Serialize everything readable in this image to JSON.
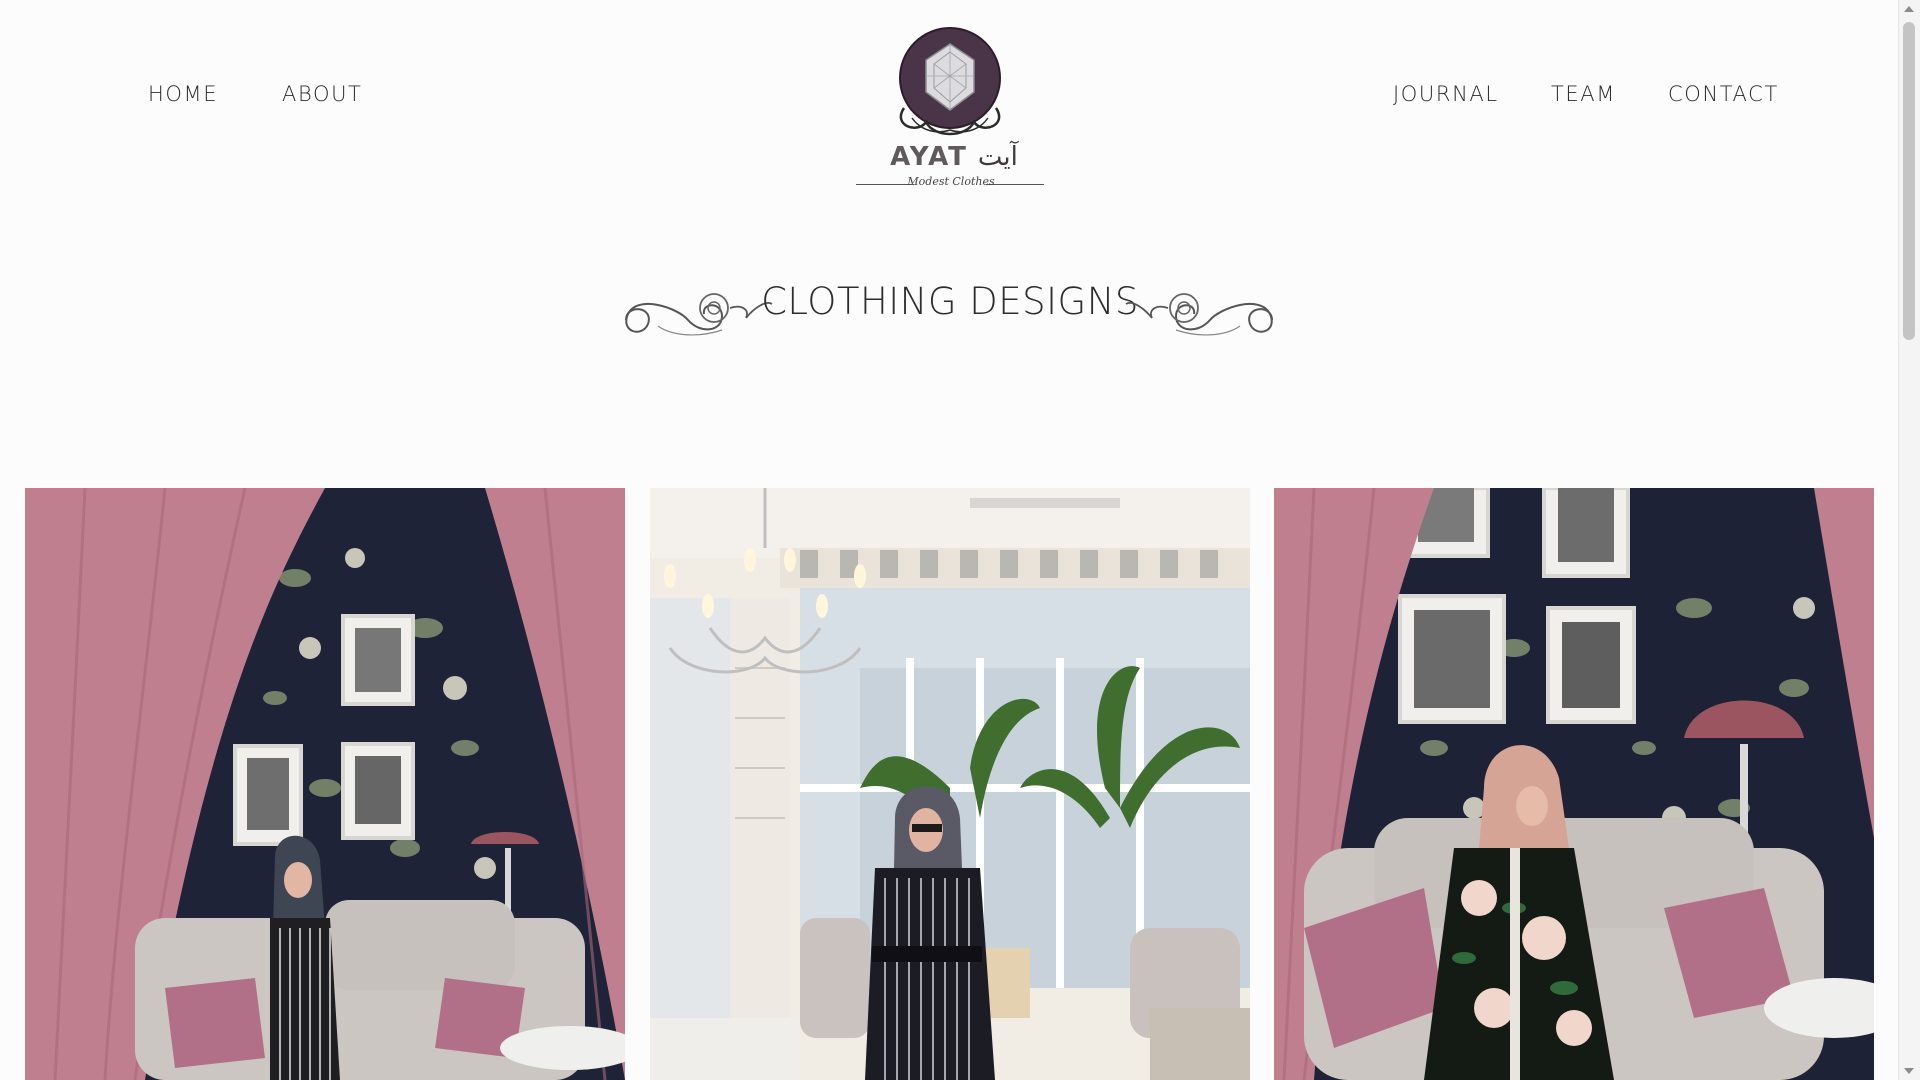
{
  "nav": {
    "left": [
      {
        "label": "HOME"
      },
      {
        "label": "ABOUT"
      }
    ],
    "right": [
      {
        "label": "JOURNAL"
      },
      {
        "label": "TEAM"
      },
      {
        "label": "CONTACT"
      }
    ]
  },
  "logo": {
    "name_latin": "AYAT",
    "name_arabic": "آيت",
    "tagline": "Modest Clothes",
    "emblem_color": "#4a3448"
  },
  "section": {
    "title": "CLOTHING DESIGNS"
  },
  "gallery": [
    {
      "description_icon": "photo-woman-striped-dress-pink-curtains"
    },
    {
      "description_icon": "photo-woman-striped-dress-chandelier-room"
    },
    {
      "description_icon": "photo-woman-floral-dress-sofa"
    }
  ],
  "colors": {
    "curtain_pink": "#c07f8f",
    "wallpaper_navy": "#1e2236",
    "text": "#2b2b2b"
  }
}
